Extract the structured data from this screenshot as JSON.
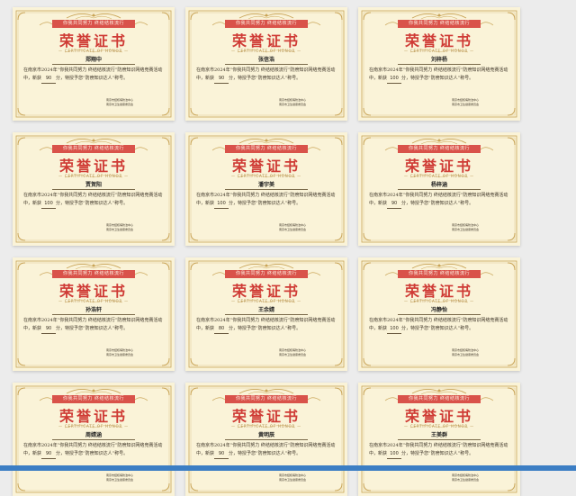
{
  "certificate": {
    "ribbon": "你我共同努力 终结结核流行",
    "title": "荣誉证书",
    "subtitle": "— CERTIFICATE OF HONOR —",
    "body_before": "在南京市2024年“你我共同努力 终结结核流行”防痨知识网络竞赛活动中，新获",
    "body_after": "分，特授予您“防痨知识达人”称号。",
    "org_line1": "南京市结核病防治中心",
    "org_line2": "南京市卫生健康委员会"
  },
  "certificates": [
    {
      "name": "郑翔中",
      "score": "90"
    },
    {
      "name": "张信浩",
      "score": "90"
    },
    {
      "name": "刘梓杨",
      "score": "100"
    },
    {
      "name": "贾贺阳",
      "score": "100"
    },
    {
      "name": "潘宇美",
      "score": "100"
    },
    {
      "name": "杨梓涵",
      "score": "90"
    },
    {
      "name": "孙浩轩",
      "score": "90"
    },
    {
      "name": "王余婧",
      "score": "80"
    },
    {
      "name": "冯静怡",
      "score": "100"
    },
    {
      "name": "周婧涵",
      "score": "90"
    },
    {
      "name": "黄明辰",
      "score": "90"
    },
    {
      "name": "王美群",
      "score": "100"
    }
  ],
  "colors": {
    "paper": "#faf3d8",
    "gold": "#c9a457",
    "title_red": "#cf3b35",
    "ribbon_red": "#d9524a",
    "page_bg": "#ececec",
    "bottom_bar": "#3c7ec4"
  }
}
